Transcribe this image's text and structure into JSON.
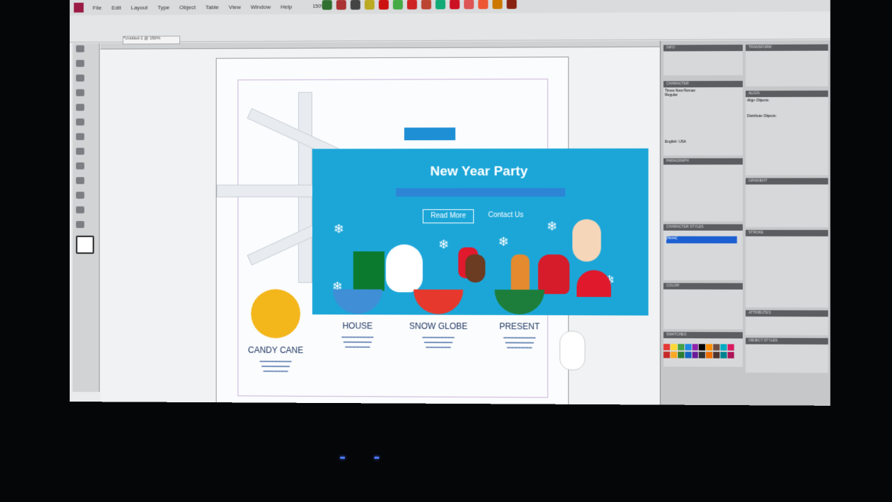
{
  "menu": {
    "items": [
      "File",
      "Edit",
      "Layout",
      "Type",
      "Object",
      "Table",
      "View",
      "Window",
      "Help"
    ],
    "zoom": "150%"
  },
  "document": {
    "tab_title": "*Untitled-1 @ 150%"
  },
  "banner": {
    "title": "New Year Party",
    "read_more": "Read More",
    "contact": "Contact Us"
  },
  "categories": [
    {
      "title": "CANDY CANE",
      "color": "#f3b61b"
    },
    {
      "title": "HOUSE",
      "color": "#3f8ed6"
    },
    {
      "title": "SNOW GLOBE",
      "color": "#e6382d"
    },
    {
      "title": "PRESENT",
      "color": "#1c7e3a"
    }
  ],
  "panels": {
    "info": "INFO",
    "transform": "TRANSFORM",
    "character": "CHARACTER",
    "font": "Times New Roman",
    "style": "Regular",
    "align": "ALIGN",
    "align_objects": "Align Objects:",
    "distribute_objects": "Distribute Objects:",
    "paragraph": "PARAGRAPH",
    "gradient": "GRADIENT",
    "character_styles": "CHARACTER STYLES",
    "none_style": "[None]",
    "stroke": "STROKE",
    "color": "COLOR",
    "swatches": "SWATCHES",
    "attributes": "ATTRIBUTES",
    "object_styles": "OBJECT STYLES",
    "language": "English: USA"
  }
}
